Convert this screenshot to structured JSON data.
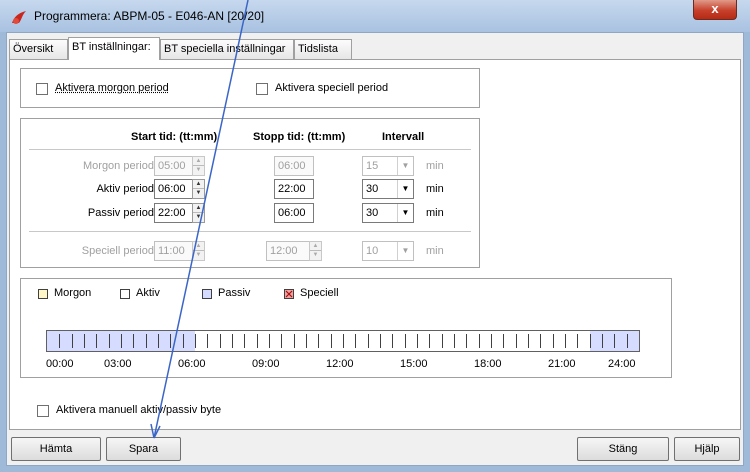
{
  "window": {
    "title": "Programmera: ABPM-05 - E046-AN  [20/20]",
    "close_glyph": "x"
  },
  "tabs": [
    {
      "label": "Översikt",
      "active": false
    },
    {
      "label": "BT inställningar:",
      "active": true
    },
    {
      "label": "BT speciella inställningar",
      "active": false
    },
    {
      "label": "Tidslista",
      "active": false
    }
  ],
  "activation": {
    "morning_label": "Aktivera morgon period",
    "morning_checked": false,
    "special_label": "Aktivera speciell period",
    "special_checked": false
  },
  "schedule": {
    "headers": {
      "start": "Start tid: (tt:mm)",
      "stop": "Stopp tid: (tt:mm)",
      "interval": "Intervall"
    },
    "unit": "min",
    "rows": [
      {
        "label": "Morgon period:",
        "start": "05:00",
        "stop": "06:00",
        "interval": "15",
        "enabled": false
      },
      {
        "label": "Aktiv period:",
        "start": "06:00",
        "stop": "22:00",
        "interval": "30",
        "enabled": true
      },
      {
        "label": "Passiv period:",
        "start": "22:00",
        "stop": "06:00",
        "interval": "30",
        "enabled": true
      },
      {
        "label": "Speciell period:",
        "start": "11:00",
        "stop": "12:00",
        "interval": "10",
        "enabled": false
      }
    ]
  },
  "legend": [
    {
      "label": "Morgon",
      "color": "#fff7c8"
    },
    {
      "label": "Aktiv",
      "color": "#ffffff"
    },
    {
      "label": "Passiv",
      "color": "#d6dcff"
    },
    {
      "label": "Speciell",
      "color": "#f2a0a0"
    }
  ],
  "timeline": {
    "hour_labels": [
      "00:00",
      "03:00",
      "06:00",
      "09:00",
      "12:00",
      "15:00",
      "18:00",
      "21:00",
      "24:00"
    ],
    "passive_color": "#d6dcff",
    "active_color": "#ffffff",
    "passive_end_hour": 6,
    "passive_start_hour": 22
  },
  "manual_switch": {
    "label": "Aktivera manuell aktiv/passiv byte",
    "checked": false
  },
  "buttons": {
    "fetch": "Hämta",
    "save": "Spara",
    "close": "Stäng",
    "help": "Hjälp"
  },
  "annotation_color": "#3a66c8"
}
